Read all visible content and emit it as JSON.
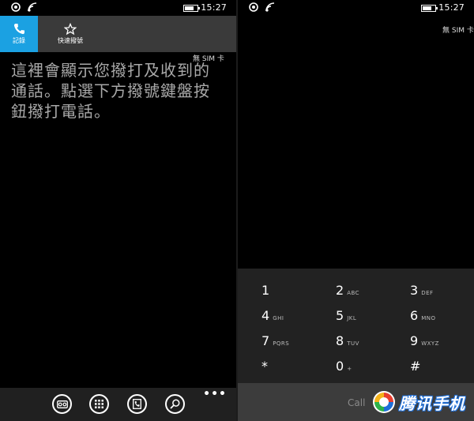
{
  "status_bar": {
    "time": "15:27"
  },
  "left_screen": {
    "tabs": [
      {
        "label": "記錄",
        "icon": "phone-icon",
        "active": true
      },
      {
        "label": "快速撥號",
        "icon": "star-icon",
        "active": false
      }
    ],
    "sim_status": "無 SIM 卡",
    "empty_message": "這裡會顯示您撥打及收到的通話。點選下方撥號鍵盤按鈕撥打電話。",
    "appbar": {
      "buttons": [
        "voicemail-icon",
        "keypad-icon",
        "contacts-icon",
        "search-icon"
      ],
      "more": "•••"
    }
  },
  "right_screen": {
    "sim_status": "無 SIM 卡",
    "keypad": [
      {
        "digit": "1",
        "letters": ""
      },
      {
        "digit": "2",
        "letters": "ABC"
      },
      {
        "digit": "3",
        "letters": "DEF"
      },
      {
        "digit": "4",
        "letters": "GHI"
      },
      {
        "digit": "5",
        "letters": "JKL"
      },
      {
        "digit": "6",
        "letters": "MNO"
      },
      {
        "digit": "7",
        "letters": "PQRS"
      },
      {
        "digit": "8",
        "letters": "TUV"
      },
      {
        "digit": "9",
        "letters": "WXYZ"
      },
      {
        "digit": "*",
        "letters": ""
      },
      {
        "digit": "0",
        "letters": "+"
      },
      {
        "digit": "#",
        "letters": ""
      }
    ],
    "call_label": "Call",
    "watermark_text": "腾讯手机"
  },
  "colors": {
    "accent": "#1ba1e2",
    "tab_bar": "#3a3a3a",
    "keypad_bg": "#222222",
    "call_bar": "#3c3c3c"
  }
}
